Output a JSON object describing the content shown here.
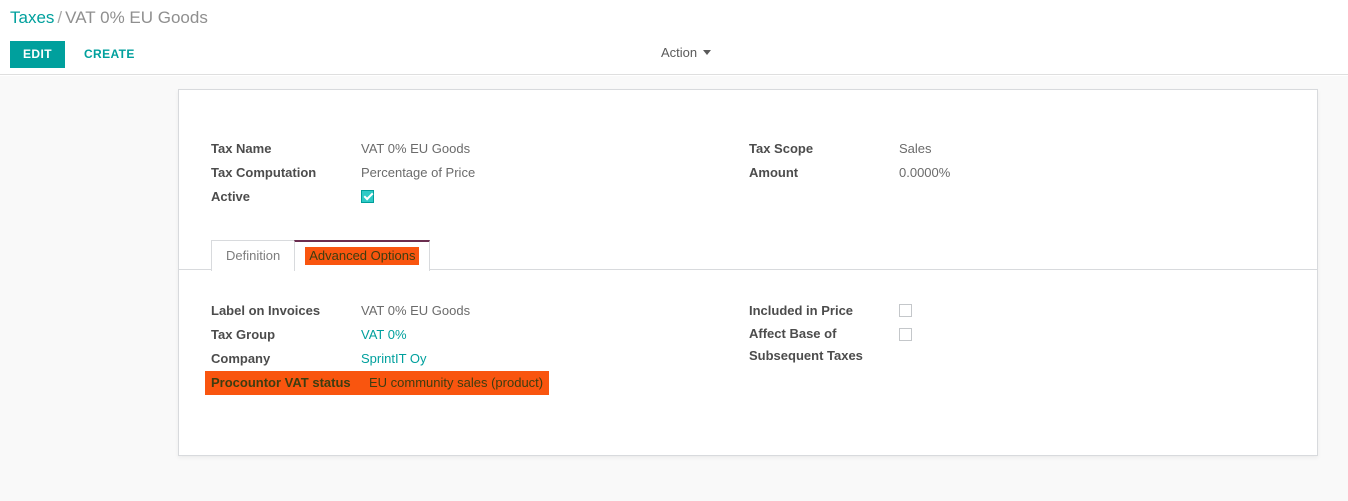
{
  "header": {
    "breadcrumb": {
      "parent": "Taxes",
      "separator": "/",
      "current": "VAT 0% EU Goods"
    },
    "edit_label": "EDIT",
    "create_label": "CREATE",
    "action_label": "Action",
    "caret_icon": "chevron-down-icon"
  },
  "form": {
    "top": {
      "left": [
        {
          "label": "Tax Name",
          "value": "VAT 0% EU Goods",
          "type": "text"
        },
        {
          "label": "Tax Computation",
          "value": "Percentage of Price",
          "type": "text"
        },
        {
          "label": "Active",
          "value": "",
          "type": "checkbox",
          "checked": true
        }
      ],
      "right": [
        {
          "label": "Tax Scope",
          "value": "Sales",
          "type": "text"
        },
        {
          "label": "Amount",
          "value": "0.0000%",
          "type": "text"
        }
      ]
    },
    "tabs": [
      {
        "label": "Definition",
        "active": false,
        "highlighted": false
      },
      {
        "label": "Advanced Options",
        "active": true,
        "highlighted": true
      }
    ],
    "bottom": {
      "left": [
        {
          "label": "Label on Invoices",
          "value": "VAT 0% EU Goods",
          "type": "text"
        },
        {
          "label": "Tax Group",
          "value": "VAT 0%",
          "type": "link"
        },
        {
          "label": "Company",
          "value": "SprintIT Oy",
          "type": "link"
        },
        {
          "label": "Procountor VAT status",
          "value": "EU community sales (product)",
          "type": "text",
          "highlighted": true
        }
      ],
      "right": [
        {
          "label": "Included in Price",
          "value": "",
          "type": "checkbox",
          "checked": false
        },
        {
          "label": "Affect Base of Subsequent Taxes",
          "value": "",
          "type": "checkbox",
          "checked": false
        }
      ]
    }
  },
  "colors": {
    "accent_teal": "#00a09d",
    "highlight_orange": "#f9550f",
    "active_tab_border": "#6b2d4f",
    "page_bg": "#f9f9f9"
  }
}
